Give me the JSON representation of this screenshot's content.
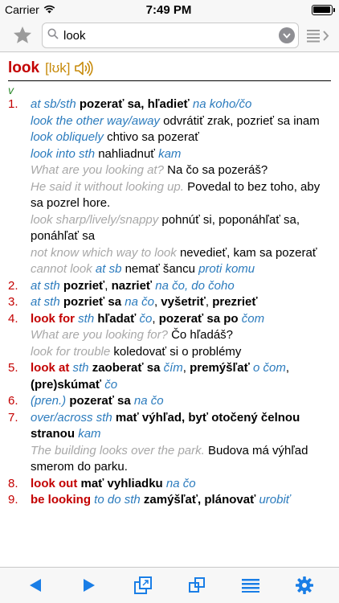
{
  "status": {
    "carrier": "Carrier",
    "time": "7:49 PM"
  },
  "search": {
    "value": "look"
  },
  "entry": {
    "headword": "look",
    "pronunciation": "[lʊk]",
    "pos": "v",
    "senses": [
      {
        "num": "1.",
        "lines": [
          [
            [
              "lab",
              "at sb/sth "
            ],
            [
              "b",
              "pozerať sa, hľadieť "
            ],
            [
              "lab",
              "na koho/čo"
            ]
          ],
          [
            [
              "lab",
              "look the other way/away "
            ],
            [
              "n",
              "odvrátiť zrak, pozrieť sa inam"
            ]
          ],
          [
            [
              "lab",
              "look obliquely "
            ],
            [
              "n",
              "chtivo sa pozerať"
            ]
          ],
          [
            [
              "lab",
              "look into sth "
            ],
            [
              "n",
              "nahliadnuť "
            ],
            [
              "lab",
              "kam"
            ]
          ],
          [
            [
              "gray",
              "What are you looking at? "
            ],
            [
              "n",
              "Na čo sa pozeráš?"
            ]
          ],
          [
            [
              "gray",
              "He said it without looking up. "
            ],
            [
              "n",
              "Povedal to bez toho, aby sa pozrel hore."
            ]
          ],
          [
            [
              "gray",
              "look sharp/lively/snappy "
            ],
            [
              "n",
              "pohnúť si, poponáhľať sa, ponáhľať sa"
            ]
          ],
          [
            [
              "gray",
              "not know which way to look "
            ],
            [
              "n",
              "nevedieť, kam sa pozerať"
            ]
          ],
          [
            [
              "gray",
              "cannot look "
            ],
            [
              "lab",
              "at sb "
            ],
            [
              "n",
              "nemať šancu "
            ],
            [
              "lab",
              "proti komu"
            ]
          ]
        ]
      },
      {
        "num": "2.",
        "lines": [
          [
            [
              "lab",
              "at sth "
            ],
            [
              "b",
              "pozrieť"
            ],
            [
              "n",
              ", "
            ],
            [
              "b",
              "nazrieť "
            ],
            [
              "lab",
              "na čo, do čoho"
            ]
          ]
        ]
      },
      {
        "num": "3.",
        "lines": [
          [
            [
              "lab",
              "at sth "
            ],
            [
              "b",
              "pozrieť sa "
            ],
            [
              "lab",
              "na čo"
            ],
            [
              "n",
              ", "
            ],
            [
              "b",
              "vyšetriť"
            ],
            [
              "n",
              ", "
            ],
            [
              "b",
              "prezrieť"
            ]
          ]
        ]
      },
      {
        "num": "4.",
        "lines": [
          [
            [
              "red",
              "look for "
            ],
            [
              "lab",
              "sth "
            ],
            [
              "b",
              "hľadať "
            ],
            [
              "lab",
              "čo"
            ],
            [
              "n",
              ", "
            ],
            [
              "b",
              "pozerať sa po "
            ],
            [
              "lab",
              "čom"
            ]
          ],
          [
            [
              "gray",
              "What are you looking for? "
            ],
            [
              "n",
              "Čo hľadáš?"
            ]
          ],
          [
            [
              "gray",
              "look for trouble "
            ],
            [
              "n",
              "koledovať si o problémy"
            ]
          ]
        ]
      },
      {
        "num": "5.",
        "lines": [
          [
            [
              "red",
              "look at "
            ],
            [
              "lab",
              "sth "
            ],
            [
              "b",
              "zaoberať sa "
            ],
            [
              "lab",
              "čím"
            ],
            [
              "n",
              ", "
            ],
            [
              "b",
              "premýšľať "
            ],
            [
              "lab",
              "o čom"
            ],
            [
              "n",
              ", "
            ],
            [
              "b",
              "(pre)skúmať "
            ],
            [
              "lab",
              "čo"
            ]
          ]
        ]
      },
      {
        "num": "6.",
        "lines": [
          [
            [
              "lab",
              "(pren.) "
            ],
            [
              "b",
              "pozerať sa "
            ],
            [
              "lab",
              "na čo"
            ]
          ]
        ]
      },
      {
        "num": "7.",
        "lines": [
          [
            [
              "lab",
              "over/across sth "
            ],
            [
              "b",
              "mať výhľad, byť otočený čelnou stranou "
            ],
            [
              "lab",
              "kam"
            ]
          ],
          [
            [
              "gray",
              "The building looks over the park. "
            ],
            [
              "n",
              "Budova má výhľad smerom do parku."
            ]
          ]
        ]
      },
      {
        "num": "8.",
        "lines": [
          [
            [
              "red",
              "look out "
            ],
            [
              "b",
              "mať vyhliadku "
            ],
            [
              "lab",
              "na čo"
            ]
          ]
        ]
      },
      {
        "num": "9.",
        "lines": [
          [
            [
              "red",
              "be looking "
            ],
            [
              "lab",
              "to do sth "
            ],
            [
              "b",
              "zamýšľať, plánovať "
            ],
            [
              "lab",
              "urobiť"
            ]
          ]
        ]
      }
    ]
  },
  "icons": {
    "star": "star-icon",
    "clear": "chevron-down-icon",
    "list": "list-view-icon",
    "back": "back-arrow-icon",
    "forward": "forward-arrow-icon",
    "window": "window-icon",
    "copy": "copy-icon",
    "menu": "menu-icon",
    "settings": "gear-icon"
  },
  "colors": {
    "accent": "#1a7ee6",
    "headword": "#c30000",
    "pronunciation": "#c78a0a",
    "label": "#2b7bbd",
    "example": "#a8a8a8",
    "pos": "#2e8b2e"
  }
}
